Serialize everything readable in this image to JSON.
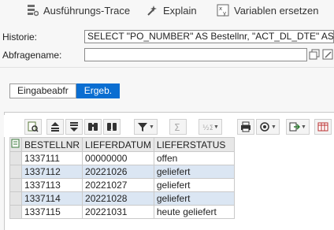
{
  "toolbar": {
    "trace_label": "Ausführungs-Trace",
    "explain_label": "Explain",
    "replace_label": "Variablen ersetzen"
  },
  "form": {
    "history_label": "Historie:",
    "history_value": "SELECT \"PO_NUMBER\" AS Bestellnr, \"ACT_DL_DTE\" AS LIEF",
    "queryname_label": "Abfragename:",
    "queryname_value": ""
  },
  "tabs": [
    {
      "label": "Eingabeabfr",
      "active": false
    },
    {
      "label": "Ergeb.",
      "active": true
    }
  ],
  "results": {
    "columns": [
      "BESTELLNR",
      "LIEFERDATUM",
      "LIEFERSTATUS"
    ],
    "rows": [
      [
        "1337111",
        "00000000",
        "offen"
      ],
      [
        "1337112",
        "20221026",
        "geliefert"
      ],
      [
        "1337113",
        "20221027",
        "geliefert"
      ],
      [
        "1337114",
        "20221028",
        "geliefert"
      ],
      [
        "1337115",
        "20221031",
        "heute geliefert"
      ]
    ]
  },
  "colors": {
    "accent": "#0a6ed1",
    "row_alt": "#dbe6f3"
  },
  "icons": {
    "trace": "trace-icon",
    "explain": "wand-icon",
    "replace": "variable-replace-icon"
  }
}
